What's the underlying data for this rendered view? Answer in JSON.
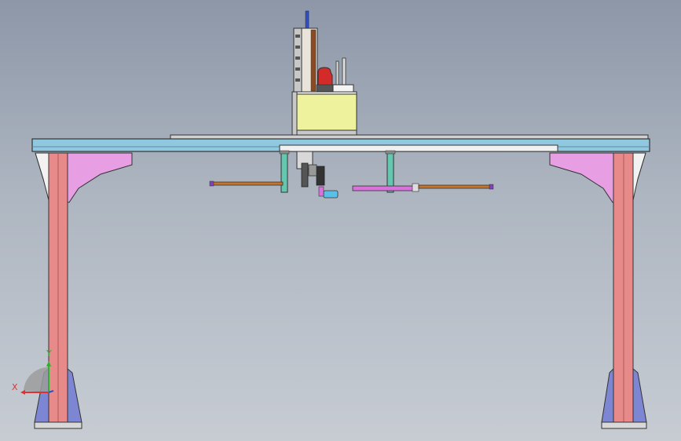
{
  "viewport": {
    "background_top": "#8d97a8",
    "background_bottom": "#c7ccd3"
  },
  "colors": {
    "beam": "#8fc8df",
    "leg": "#e98a8a",
    "bracket": "#e79ee3",
    "foot": "#7c86d2",
    "housing": "#eef29c",
    "motor": "#d42a2a",
    "rod": "#c5742c",
    "post": "#64c8b0",
    "cylinder": "#5ac0e8",
    "arm": "#d873dc"
  },
  "triad": {
    "x_label": "X",
    "y_label": "Y",
    "x_color": "#e03030",
    "y_color": "#30b030"
  }
}
